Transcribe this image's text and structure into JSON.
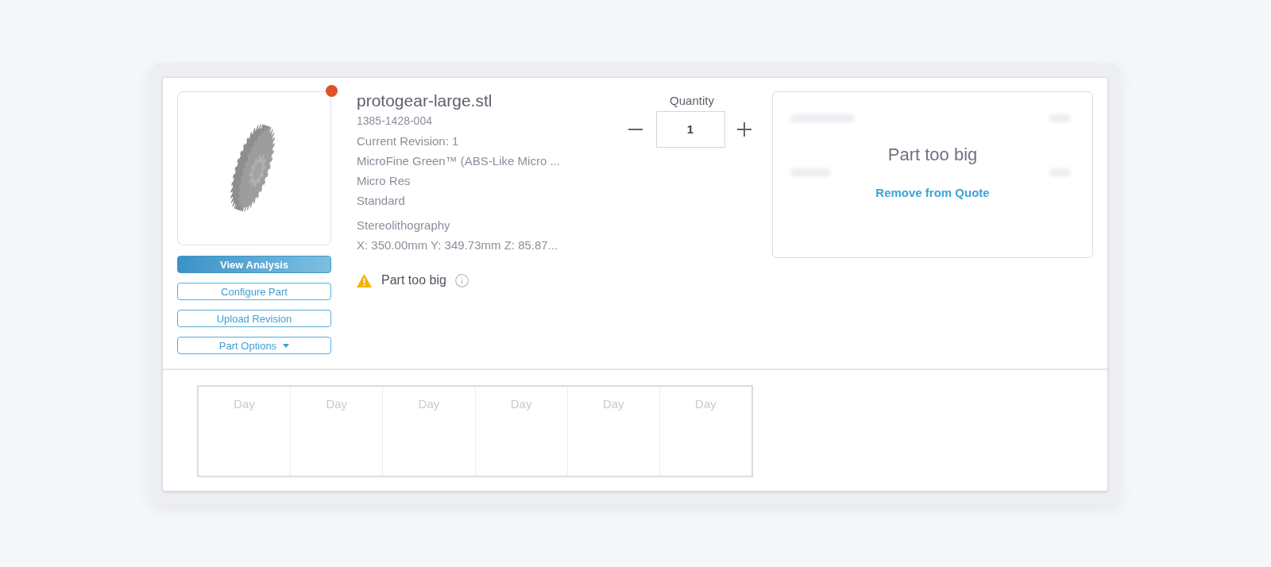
{
  "thumbnail": {
    "flagged": true
  },
  "buttons": [
    {
      "label": "View Analysis",
      "kind": "primary",
      "dropdown": false
    },
    {
      "label": "Configure Part",
      "kind": "outline",
      "dropdown": false
    },
    {
      "label": "Upload Revision",
      "kind": "outline",
      "dropdown": false
    },
    {
      "label": "Part Options",
      "kind": "outline",
      "dropdown": true
    }
  ],
  "part": {
    "filename": "protogear-large.stl",
    "part_number": "1385-1428-004",
    "revision": "Current Revision: 1",
    "material": "MicroFine Green™ (ABS-Like Micro ...",
    "resolution": "Micro Res",
    "finish": "Standard",
    "process": "Stereolithography",
    "dimensions": "X: 350.00mm Y: 349.73mm Z: 85.87..."
  },
  "warning": {
    "text": "Part too big"
  },
  "quantity": {
    "label": "Quantity",
    "value": "1"
  },
  "price_panel": {
    "message": "Part too big",
    "action": "Remove from Quote"
  },
  "lead_times": [
    "Day",
    "Day",
    "Day",
    "Day",
    "Day",
    "Day"
  ]
}
